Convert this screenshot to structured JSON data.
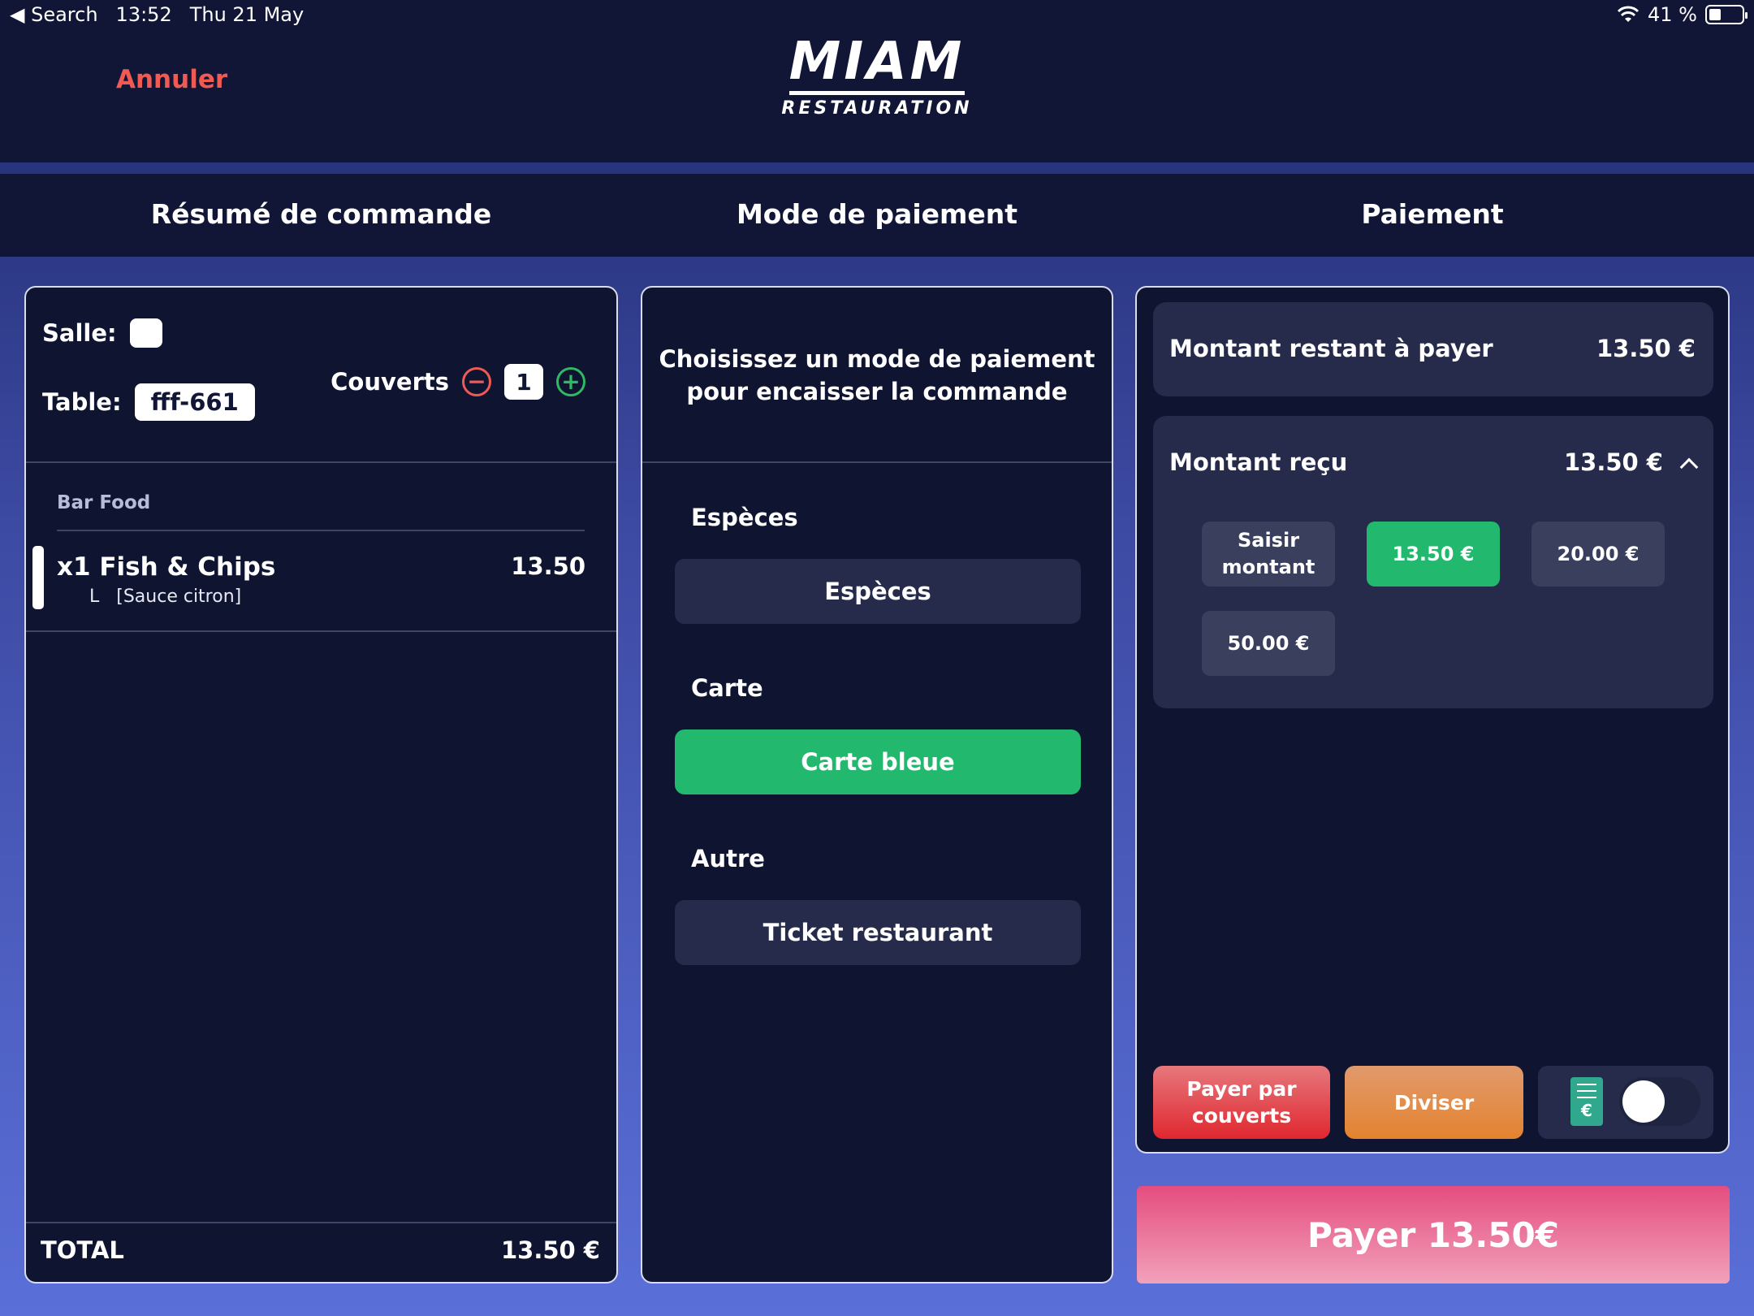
{
  "status_bar": {
    "back": "◀ Search",
    "time": "13:52",
    "date": "Thu 21 May",
    "battery": "41 %"
  },
  "header": {
    "cancel_label": "Annuler",
    "logo_main": "MIAM",
    "logo_sub": "RESTAURATION"
  },
  "tabs": [
    "Résumé de commande",
    "Mode de paiement",
    "Paiement"
  ],
  "summary": {
    "salle_label": "Salle:",
    "table_label": "Table:",
    "table_value": "fff-661",
    "couverts_label": "Couverts",
    "couverts_count": "1",
    "category": "Bar Food",
    "items": [
      {
        "name": "x1 Fish & Chips",
        "price": "13.50",
        "modifier_size": "L",
        "modifier": "[Sauce citron]"
      }
    ],
    "total_label": "TOTAL",
    "total_value": "13.50 €"
  },
  "payment_mode": {
    "prompt": "Choisissez un mode de paiement pour encaisser la commande",
    "sections": [
      {
        "label": "Espèces",
        "button": "Espèces",
        "selected": false
      },
      {
        "label": "Carte",
        "button": "Carte bleue",
        "selected": true
      },
      {
        "label": "Autre",
        "button": "Ticket restaurant",
        "selected": false
      }
    ]
  },
  "payment": {
    "remaining_label": "Montant restant à payer",
    "remaining_value": "13.50 €",
    "received_label": "Montant reçu",
    "received_value": "13.50 €",
    "amount_options": [
      "Saisir montant",
      "13.50 €",
      "20.00 €",
      "50.00 €"
    ],
    "selected_amount": "13.50 €",
    "pay_per_cover": "Payer par couverts",
    "split": "Diviser",
    "receipt_toggle": false,
    "pay_button": "Payer 13.50€"
  },
  "colors": {
    "accent_green": "#22b86e",
    "cancel_red": "#ef5a52",
    "background": "#121636"
  }
}
